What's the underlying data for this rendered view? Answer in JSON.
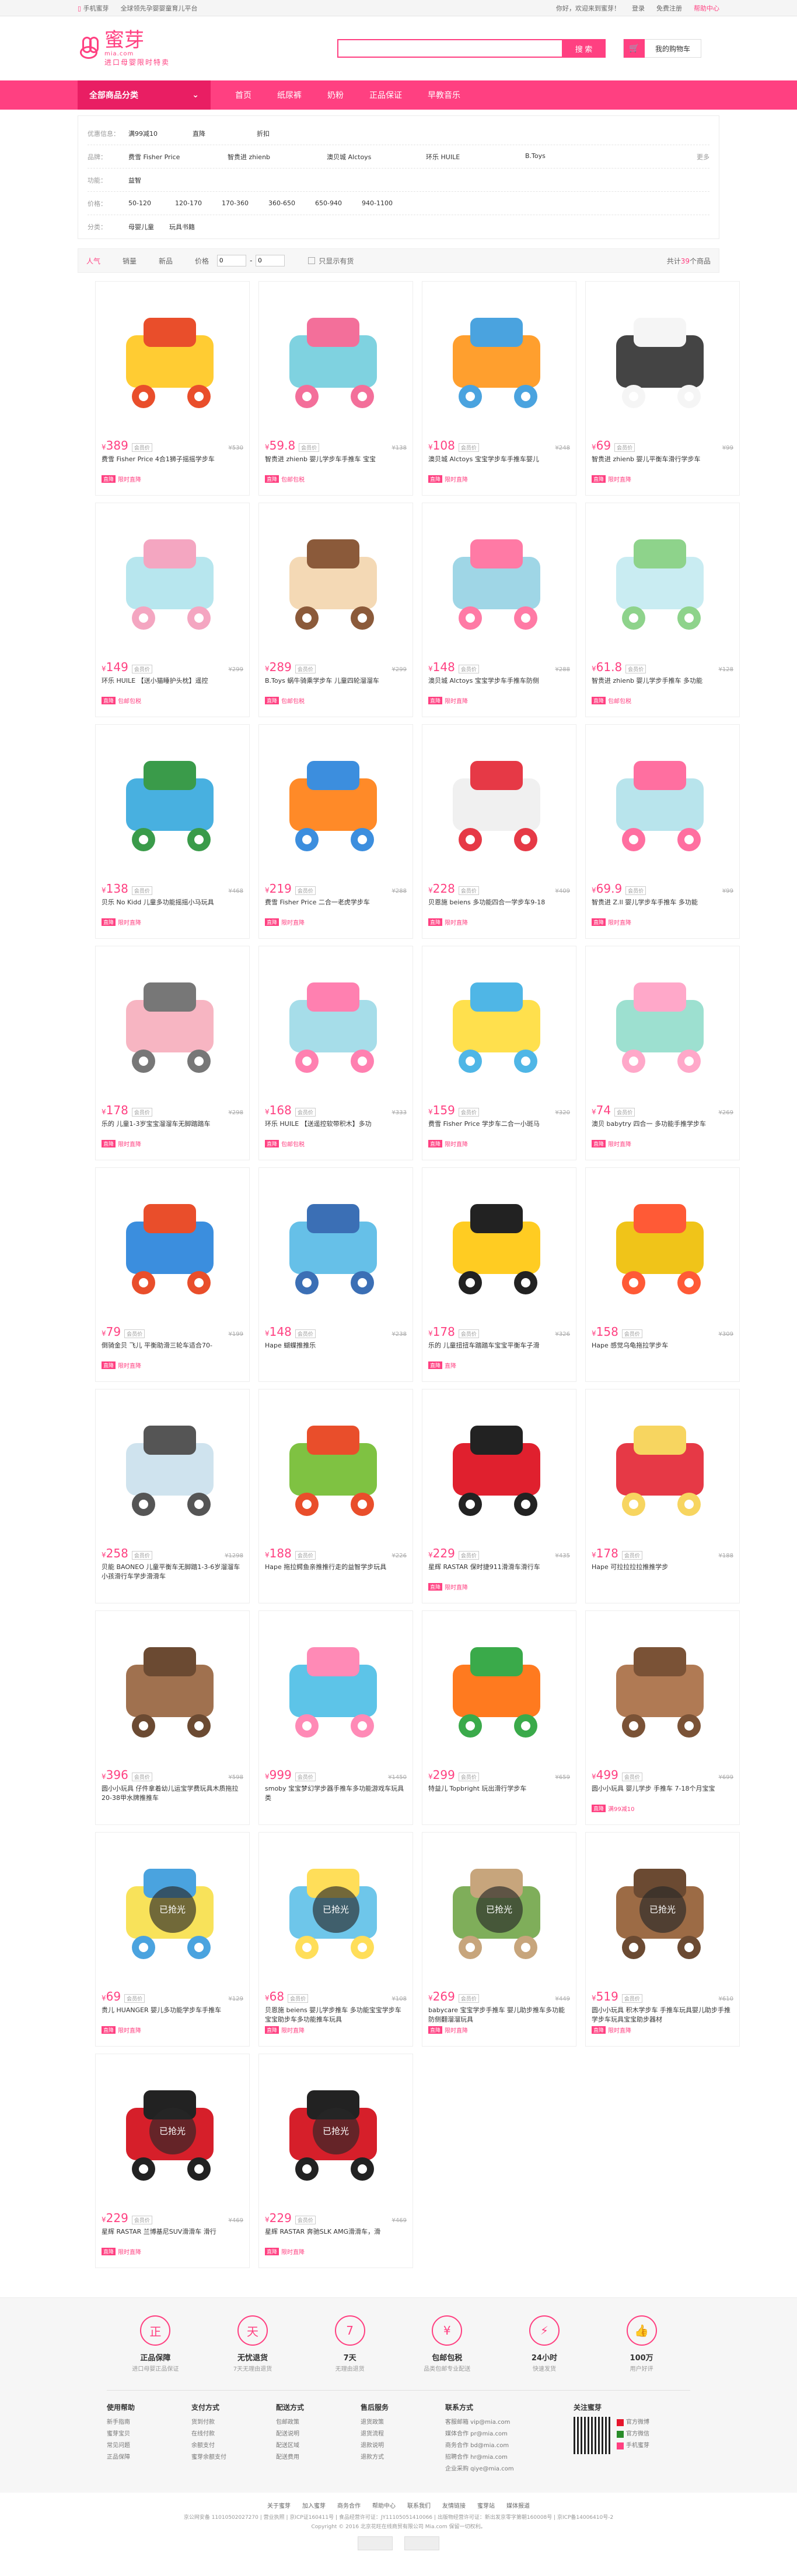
{
  "topbar": {
    "phone": "手机蜜芽",
    "slogan": "全球领先孕婴婴童育儿平台",
    "login": "你好，欢迎来到蜜芽！",
    "signin": "登录",
    "register": "免费注册",
    "help": "帮助中心"
  },
  "header": {
    "logo": "蜜芽",
    "logo_sub": "mia.com",
    "logo_tagline": "进口母婴限时特卖",
    "search_placeholder": "",
    "search_button": "搜 索",
    "cart_label": "我的购物车"
  },
  "nav": {
    "category": "全部商品分类",
    "links": [
      "首页",
      "纸尿裤",
      "奶粉",
      "正品保证",
      "早教音乐"
    ]
  },
  "filter": {
    "rows": [
      {
        "key": "优惠信息：",
        "values": [
          "满99减10",
          "直降",
          "折扣"
        ]
      },
      {
        "key": "品牌：",
        "values": [
          "费雪 Fisher Price",
          "智贵进 zhienb",
          "澳贝城 Alctoys",
          "环乐 HUILE",
          "B.Toys"
        ],
        "more": "更多"
      },
      {
        "key": "功能：",
        "values": [
          "益智"
        ]
      },
      {
        "key": "价格：",
        "values": [
          "50-120",
          "120-170",
          "170-360",
          "360-650",
          "650-940",
          "940-1100"
        ]
      },
      {
        "key": "分类：",
        "values": [
          "母婴儿童",
          "玩具书籍"
        ]
      }
    ]
  },
  "sortbar": {
    "items": [
      "人气",
      "销量",
      "新品",
      "价格"
    ],
    "price_from": "0",
    "price_to": "0",
    "stock_only": "只显示有货",
    "count_prefix": "共计",
    "count": "39",
    "count_suffix": "个商品"
  },
  "products": [
    {
      "price": "389",
      "old": "¥530",
      "name": "费雪 Fisher Price 4合1狮子摇摇学步车",
      "promo": "限时直降",
      "sold": ""
    },
    {
      "price": "59.8",
      "old": "¥138",
      "name": "智贵进 zhienb 婴儿学步车手推车 宝宝",
      "promo": "包邮包税",
      "sold": ""
    },
    {
      "price": "108",
      "old": "¥248",
      "name": "澳贝城 Alctoys 宝宝学步车手推车婴儿",
      "promo": "限时直降",
      "sold": ""
    },
    {
      "price": "69",
      "old": "¥99",
      "name": "智贵进 zhienb 婴儿平衡车滑行学步车",
      "promo": "限时直降",
      "sold": ""
    },
    {
      "price": "149",
      "old": "¥299",
      "name": "环乐 HUILE 【送小猫睡护头枕】遥控",
      "promo": "包邮包税",
      "sold": ""
    },
    {
      "price": "289",
      "old": "¥299",
      "name": "B.Toys 蜗牛骑乘学步车 儿童四轮溜溜车",
      "promo": "包邮包税",
      "sold": ""
    },
    {
      "price": "148",
      "old": "¥288",
      "name": "澳贝城 Alctoys 宝宝学步车手推车防侧",
      "promo": "限时直降",
      "sold": ""
    },
    {
      "price": "61.8",
      "old": "¥128",
      "name": "智贵进 zhienb 婴儿学步手推车 多功能",
      "promo": "包邮包税",
      "sold": ""
    },
    {
      "price": "138",
      "old": "¥468",
      "name": "贝乐 No Kidd 儿童多功能摇摇小马玩具",
      "promo": "限时直降",
      "sold": ""
    },
    {
      "price": "219",
      "old": "¥288",
      "name": "费雪 Fisher Price 二合一老虎学步车",
      "promo": "限时直降",
      "sold": ""
    },
    {
      "price": "228",
      "old": "¥409",
      "name": "贝恩施 beiens 多功能四合一学步车9-18",
      "promo": "限时直降",
      "sold": ""
    },
    {
      "price": "69.9",
      "old": "¥99",
      "name": "智贵进 Z.Il 婴儿学步车手推车 多功能",
      "promo": "限时直降",
      "sold": ""
    },
    {
      "price": "178",
      "old": "¥298",
      "name": "乐的 儿童1-3岁宝宝溜溜车无脚踏踏车",
      "promo": "限时直降",
      "sold": ""
    },
    {
      "price": "168",
      "old": "¥333",
      "name": "环乐 HUILE 【送遥控软带积木】多功",
      "promo": "包邮包税",
      "sold": ""
    },
    {
      "price": "159",
      "old": "¥320",
      "name": "费雪 Fisher Price 学步车二合一小斑马",
      "promo": "限时直降",
      "sold": ""
    },
    {
      "price": "74",
      "old": "¥269",
      "name": "澳贝 babytry 四合一 多功能手推学步车",
      "promo": "限时直降",
      "sold": ""
    },
    {
      "price": "79",
      "old": "¥199",
      "name": "倒骑金贝 飞儿 平衡助滑三轮车适合70-",
      "promo": "限时直降",
      "sold": ""
    },
    {
      "price": "148",
      "old": "¥238",
      "name": "Hape 蝴蝶推推乐",
      "promo": "",
      "sold": ""
    },
    {
      "price": "178",
      "old": "¥326",
      "name": "乐的 儿童扭扭车踏踏车宝宝平衡车子滑",
      "promo": "直降",
      "sold": ""
    },
    {
      "price": "158",
      "old": "¥309",
      "name": "Hape 感觉乌龟拖拉学步车",
      "promo": "",
      "sold": ""
    },
    {
      "price": "258",
      "old": "¥1298",
      "name": "贝能 BAONEO 儿童平衡车无脚踏1-3-6岁溜溜车小孩滑行车学步滑滑车",
      "promo": "",
      "sold": ""
    },
    {
      "price": "188",
      "old": "¥226",
      "name": "Hape 拖拉鳄鱼亲推推行走的益智学步玩具",
      "promo": "",
      "sold": ""
    },
    {
      "price": "229",
      "old": "¥435",
      "name": "星辉 RASTAR 保时捷911滑滑车滑行车",
      "promo": "限时直降",
      "sold": ""
    },
    {
      "price": "178",
      "old": "¥188",
      "name": "Hape 可拉拉拉拉推推学步",
      "promo": "",
      "sold": ""
    },
    {
      "price": "396",
      "old": "¥598",
      "name": "圆小小玩具 仔件拿着幼儿运宝学费玩具木质拖拉20-38甲水牌推推车",
      "promo": "",
      "sold": ""
    },
    {
      "price": "999",
      "old": "¥1450",
      "name": "smoby 宝宝梦幻学步器手推车多功能游戏车玩具类",
      "promo": "",
      "sold": ""
    },
    {
      "price": "299",
      "old": "¥659",
      "name": "特益儿 Topbright 玩出滑行学步车",
      "promo": "",
      "sold": ""
    },
    {
      "price": "499",
      "old": "¥699",
      "name": "圆小小玩具 婴儿学步 手推车 7-18个月宝宝",
      "promo": "满99减10",
      "sold": ""
    },
    {
      "price": "69",
      "old": "¥129",
      "name": "贵儿 HUANGER 婴儿多功能学步车手推车",
      "promo": "限时直降",
      "sold": "已抢光"
    },
    {
      "price": "68",
      "old": "¥108",
      "name": "贝恩施 beiens 婴儿学步推车 多功能宝宝学步车宝宝助步车多功能推车玩具",
      "promo": "限时直降",
      "sold": "已抢光"
    },
    {
      "price": "269",
      "old": "¥449",
      "name": "babycare 宝宝学步手推车 婴儿助步推车多功能防侧翻溜溜玩具",
      "promo": "限时直降",
      "sold": "已抢光"
    },
    {
      "price": "519",
      "old": "¥610",
      "name": "圆小小玩具 积木学步车 手推车玩具婴儿助步手推学步车玩具宝宝助步器材",
      "promo": "限时直降",
      "sold": "已抢光"
    },
    {
      "price": "229",
      "old": "¥469",
      "name": "星辉 RASTAR 兰博基尼SUV滑滑车 滑行",
      "promo": "限时直降",
      "sold": "已抢光"
    },
    {
      "price": "229",
      "old": "¥469",
      "name": "星辉 RASTAR 奔驰SLK AMG滑滑车，滑",
      "promo": "限时直降",
      "sold": "已抢光"
    }
  ],
  "footer": {
    "services": [
      {
        "icon": "正",
        "title": "正品保障",
        "sub": "进口母婴正品保证"
      },
      {
        "icon": "天",
        "title": "无忧退货",
        "sub": "7天无理由退货"
      },
      {
        "icon": "7",
        "title": "7天",
        "sub": "无理由退货"
      },
      {
        "icon": "¥",
        "title": "包邮包税",
        "sub": "品类包邮专业配送"
      },
      {
        "icon": "⚡",
        "title": "24小时",
        "sub": "快速发货"
      },
      {
        "icon": "👍",
        "title": "100万",
        "sub": "用户好评"
      }
    ],
    "cols": [
      {
        "title": "使用帮助",
        "items": [
          "新手指南",
          "蜜芽宝贝",
          "常见问题",
          "正品保障"
        ]
      },
      {
        "title": "支付方式",
        "items": [
          "货到付款",
          "在线付款",
          "余额支付",
          "蜜芽余额支付"
        ]
      },
      {
        "title": "配送方式",
        "items": [
          "包邮政策",
          "配送说明",
          "配送区域",
          "配送费用"
        ]
      },
      {
        "title": "售后服务",
        "items": [
          "退货政策",
          "退货流程",
          "退款说明",
          "退款方式"
        ]
      },
      {
        "title": "联系方式",
        "items": [
          "客服邮箱 vip@mia.com",
          "媒体合作 pr@mia.com",
          "商务合作 bd@mia.com",
          "招聘合作 hr@mia.com",
          "企业采购 qiye@mia.com"
        ]
      }
    ],
    "follow_title": "关注蜜芽",
    "apps": [
      "官方微博",
      "官方微信",
      "手机蜜芽"
    ],
    "links": [
      "关于蜜芽",
      "加入蜜芽",
      "商务合作",
      "帮助中心",
      "联系我们",
      "友情链接",
      "蜜芽站",
      "媒体报道"
    ],
    "copy1": "京公网安备 11010502027270 | 营业执照 | 京ICP证160411号 | 食品经营许可证：JY11105051410066 | 出版物经营许可证：新出发京零字第朝160008号 | 京ICP备14006410号-2",
    "copy2": "Copyright © 2016 北京花旺在线商贸有限公司 Mia.com 保留一切权利。"
  }
}
